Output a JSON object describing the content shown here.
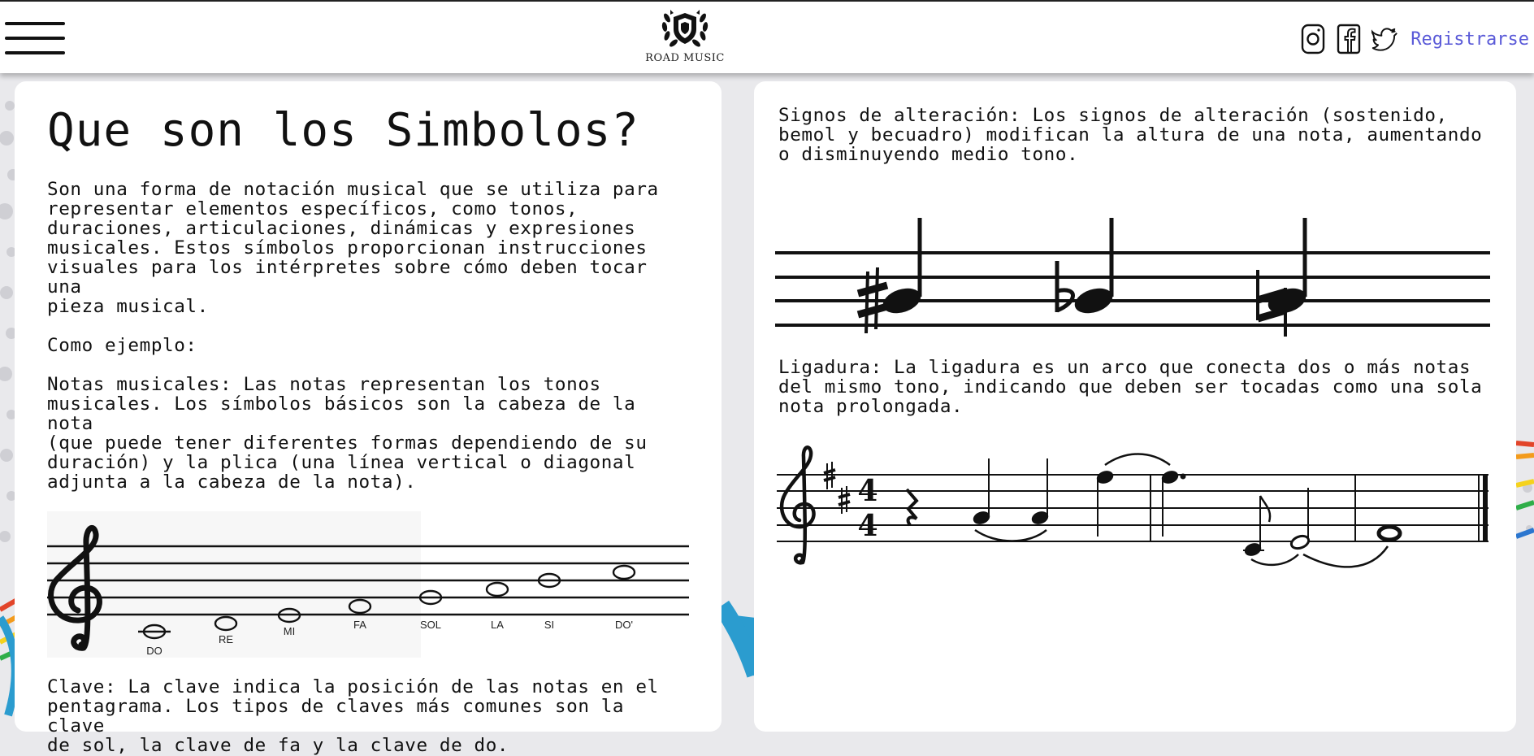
{
  "header": {
    "logo_text": "ROAD MUSIC",
    "register_label": "Registrarse",
    "icons": [
      "menu-icon",
      "instagram-icon",
      "facebook-icon",
      "twitter-icon"
    ],
    "link_color": "#5a5ad8"
  },
  "left": {
    "title": "Que son los Simbolos?",
    "intro": "Son una forma de notación musical que se utiliza para\nrepresentar elementos específicos, como tonos,\nduraciones, articulaciones, dinámicas y expresiones\nmusicales. Estos símbolos proporcionan instrucciones\nvisuales para los intérpretes sobre cómo deben tocar una\npieza musical.",
    "example_label": "Como ejemplo:",
    "notes_text": "Notas musicales: Las notas representan los tonos\nmusicales. Los símbolos básicos son la cabeza de la nota\n(que puede tener diferentes formas dependiendo de su\nduración) y la plica (una línea vertical o diagonal\nadjunta a la cabeza de la nota).",
    "scale_labels": [
      "DO",
      "RE",
      "MI",
      "FA",
      "SOL",
      "LA",
      "SI",
      "DO'"
    ],
    "clef_text": "Clave: La clave indica la posición de las notas en el\npentagrama. Los tipos de claves más comunes son la clave\nde sol, la clave de fa y la clave de do."
  },
  "right": {
    "accidentals_text": "Signos de alteración: Los signos de alteración (sostenido,\nbemol y becuadro) modifican la altura de una nota, aumentando\no disminuyendo medio tono.",
    "tie_text": "Ligadura: La ligadura es un arco que conecta dos o más notas\ndel mismo tono, indicando que deben ser tocadas como una sola\nnota prolongada.",
    "time_signature": [
      "4",
      "4"
    ]
  }
}
